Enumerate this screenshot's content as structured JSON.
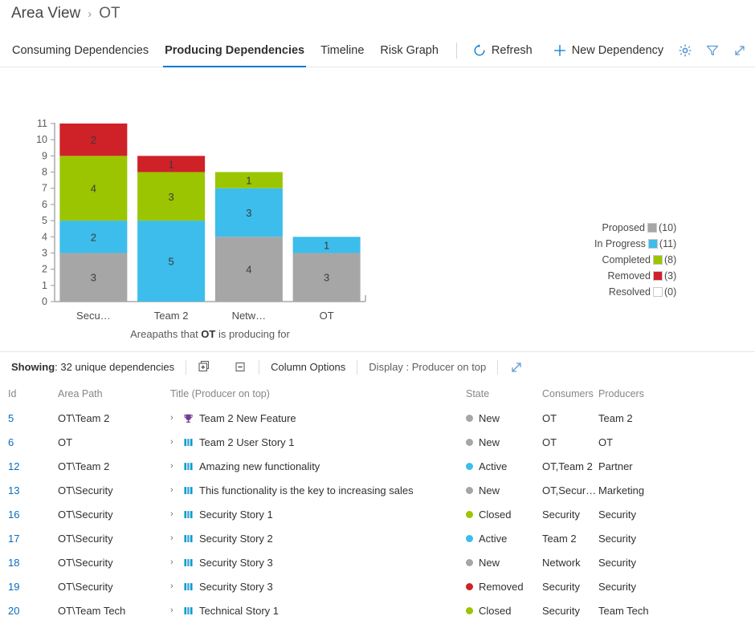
{
  "breadcrumb": {
    "root": "Area View",
    "separator": "›",
    "leaf": "OT"
  },
  "tabs": [
    {
      "label": "Consuming Dependencies",
      "active": false
    },
    {
      "label": "Producing Dependencies",
      "active": true
    },
    {
      "label": "Timeline",
      "active": false
    },
    {
      "label": "Risk Graph",
      "active": false
    }
  ],
  "commands": {
    "refresh": "Refresh",
    "new_dependency": "New Dependency",
    "settings_icon": "gear-icon",
    "filter_icon": "filter-icon",
    "fullscreen_icon": "expand-arrows-icon"
  },
  "chart_data": {
    "type": "bar",
    "title": "",
    "xlabel_prefix": "Areapaths that ",
    "xlabel_bold": "OT",
    "xlabel_suffix": " is producing for",
    "categories": [
      "Secu…",
      "Team 2",
      "Netw…",
      "OT"
    ],
    "stacked": true,
    "ylim": [
      0,
      11
    ],
    "yticks": [
      0,
      1,
      2,
      3,
      4,
      5,
      6,
      7,
      8,
      9,
      10,
      11
    ],
    "grid": false,
    "legend_position": "right",
    "series": [
      {
        "name": "Proposed",
        "color": "#a6a6a6",
        "total": 10,
        "values": [
          3,
          0,
          4,
          3
        ]
      },
      {
        "name": "In Progress",
        "color": "#3cbdec",
        "total": 11,
        "values": [
          2,
          5,
          3,
          1
        ]
      },
      {
        "name": "Completed",
        "color": "#9bc500",
        "total": 8,
        "values": [
          4,
          3,
          1,
          0
        ]
      },
      {
        "name": "Removed",
        "color": "#cf2128",
        "total": 3,
        "values": [
          2,
          1,
          0,
          0
        ]
      },
      {
        "name": "Resolved",
        "color": "#ffffff",
        "total": 0,
        "values": [
          0,
          0,
          0,
          0
        ]
      }
    ],
    "bar_totals": [
      11,
      9,
      8,
      4
    ]
  },
  "gridbar": {
    "showing_label": "Showing",
    "showing_value": ": 32 unique dependencies",
    "expand_all_icon": "expand-all-icon",
    "collapse_all_icon": "collapse-all-icon",
    "column_options": "Column Options",
    "display_label": "Display : Producer on top",
    "fullscreen_icon": "expand-arrows-icon"
  },
  "table": {
    "columns": [
      "Id",
      "Area Path",
      "Title (Producer on top)",
      "State",
      "Consumers",
      "Producers"
    ],
    "rows": [
      {
        "id": "5",
        "area": "OT\\Team 2",
        "title": "Team 2 New Feature",
        "wi_type": "feature",
        "state": "New",
        "state_color": "#a6a6a6",
        "consumers": "OT",
        "producers": "Team 2"
      },
      {
        "id": "6",
        "area": "OT",
        "title": "Team 2 User Story 1",
        "wi_type": "user-story",
        "state": "New",
        "state_color": "#a6a6a6",
        "consumers": "OT",
        "producers": "OT"
      },
      {
        "id": "12",
        "area": "OT\\Team 2",
        "title": "Amazing new functionality",
        "wi_type": "user-story",
        "state": "Active",
        "state_color": "#3cbdec",
        "consumers": "OT,Team 2",
        "producers": "Partner"
      },
      {
        "id": "13",
        "area": "OT\\Security",
        "title": "This functionality is the key to increasing sales",
        "wi_type": "user-story",
        "state": "New",
        "state_color": "#a6a6a6",
        "consumers": "OT,Secur…",
        "producers": "Marketing"
      },
      {
        "id": "16",
        "area": "OT\\Security",
        "title": "Security Story 1",
        "wi_type": "user-story",
        "state": "Closed",
        "state_color": "#9bc500",
        "consumers": "Security",
        "producers": "Security"
      },
      {
        "id": "17",
        "area": "OT\\Security",
        "title": "Security Story 2",
        "wi_type": "user-story",
        "state": "Active",
        "state_color": "#3cbdec",
        "consumers": "Team 2",
        "producers": "Security"
      },
      {
        "id": "18",
        "area": "OT\\Security",
        "title": "Security Story 3",
        "wi_type": "user-story",
        "state": "New",
        "state_color": "#a6a6a6",
        "consumers": "Network",
        "producers": "Security"
      },
      {
        "id": "19",
        "area": "OT\\Security",
        "title": "Security Story 3",
        "wi_type": "user-story",
        "state": "Removed",
        "state_color": "#cf2128",
        "consumers": "Security",
        "producers": "Security"
      },
      {
        "id": "20",
        "area": "OT\\Team Tech",
        "title": "Technical Story 1",
        "wi_type": "user-story",
        "state": "Closed",
        "state_color": "#9bc500",
        "consumers": "Security",
        "producers": "Team Tech"
      }
    ]
  }
}
